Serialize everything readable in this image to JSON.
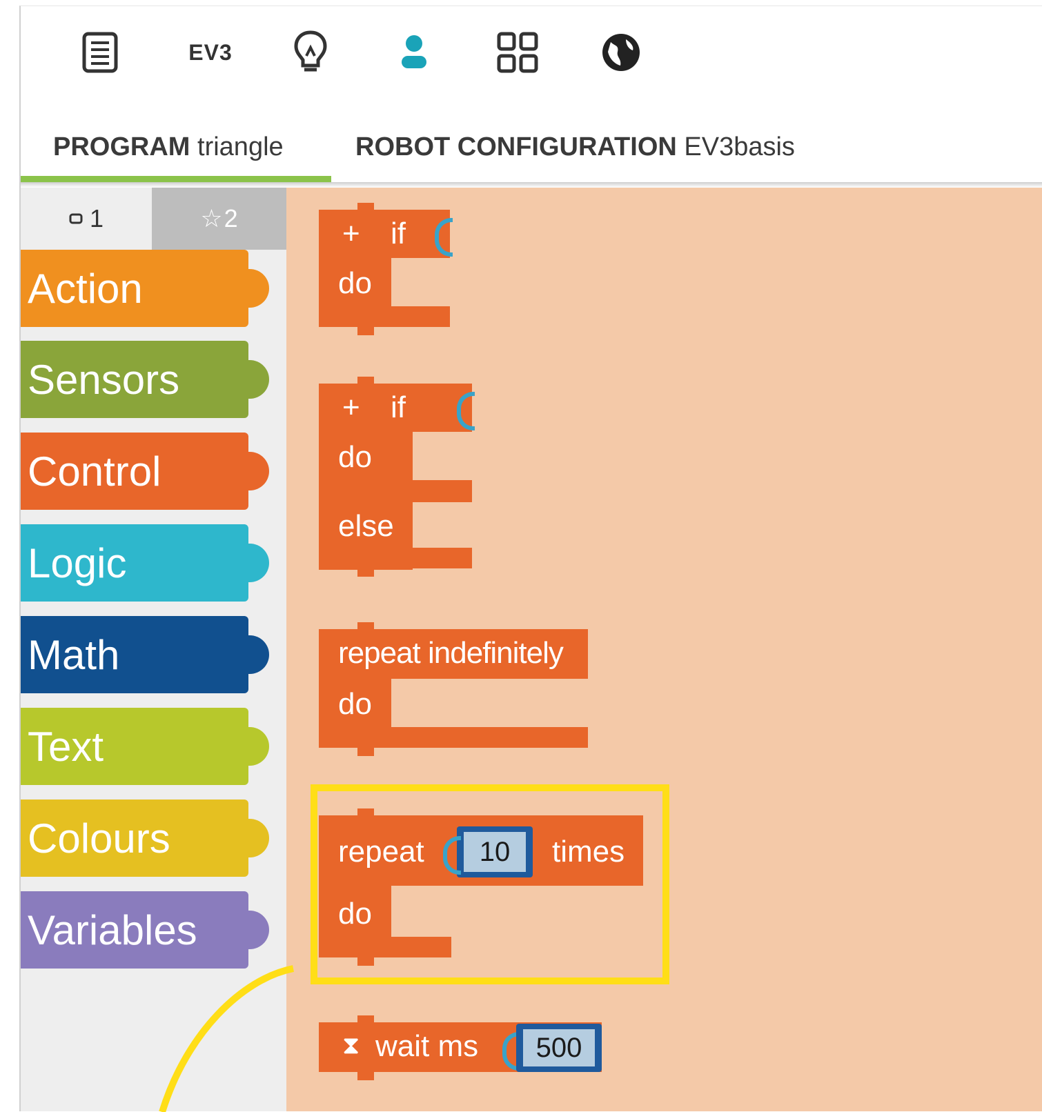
{
  "toolbar": {
    "icons": [
      "document-icon",
      "ev3-icon",
      "lightbulb-icon",
      "user-icon",
      "grid-icon",
      "globe-icon"
    ],
    "ev3_label": "EV3"
  },
  "tabs": [
    {
      "label": "PROGRAM",
      "value": "triangle"
    },
    {
      "label": "ROBOT CONFIGURATION",
      "value": "EV3basis"
    }
  ],
  "levels": [
    {
      "label": "1"
    },
    {
      "label": "2"
    }
  ],
  "categories": [
    {
      "label": "Action",
      "color": "#f0901f"
    },
    {
      "label": "Sensors",
      "color": "#8aa53a"
    },
    {
      "label": "Control",
      "color": "#e8662a"
    },
    {
      "label": "Logic",
      "color": "#2eb7cc"
    },
    {
      "label": "Math",
      "color": "#11508f"
    },
    {
      "label": "Text",
      "color": "#b7c82c"
    },
    {
      "label": "Colours",
      "color": "#e5c021"
    },
    {
      "label": "Variables",
      "color": "#8a7cbd"
    }
  ],
  "blocks": {
    "if1": {
      "plus": "+",
      "if": "if",
      "do": "do"
    },
    "if2": {
      "plus": "+",
      "if": "if",
      "do": "do",
      "else": "else"
    },
    "repeat_indef": {
      "title": "repeat indefinitely",
      "do": "do"
    },
    "repeat_times": {
      "repeat": "repeat",
      "count": "10",
      "times": "times",
      "do": "do"
    },
    "wait": {
      "label": "wait ms",
      "value": "500"
    }
  },
  "colors": {
    "control_block": "#e8662a",
    "workspace_bg": "#f4c9a8",
    "highlight": "#ffde17",
    "tab_active": "#8bc34a"
  }
}
